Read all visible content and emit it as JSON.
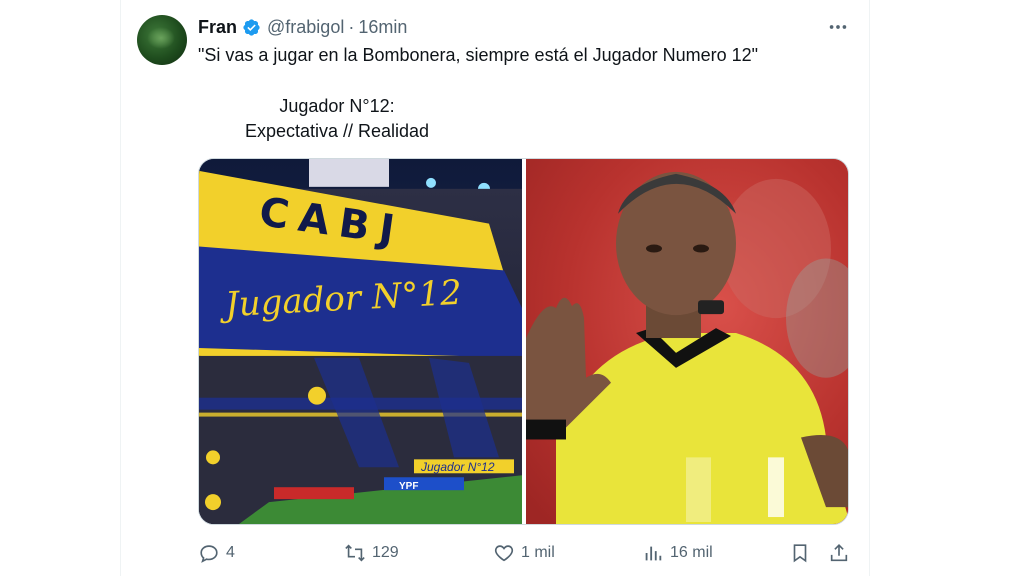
{
  "tweet": {
    "author_name": "Fran",
    "handle": "@frabigol",
    "separator": "·",
    "time": "16min",
    "text": "\"Si vas a jugar en la Bombonera, siempre está el Jugador Numero 12\"",
    "caption_line1": "Jugador N°12:",
    "caption_line2": "Expectativa // Realidad"
  },
  "media": {
    "left_banner_top": "CABJ",
    "left_banner_bottom": "Jugador N°12",
    "left_ad": "YPF",
    "left_small_banner": "Jugador N°12"
  },
  "actions": {
    "replies": "4",
    "retweets": "129",
    "likes": "1 mil",
    "views": "16 mil"
  },
  "icons": {
    "verified": "verified-badge-icon",
    "more": "more-dots-icon",
    "reply": "reply-icon",
    "retweet": "retweet-icon",
    "like": "heart-icon",
    "views": "views-chart-icon",
    "bookmark": "bookmark-icon",
    "share": "share-icon"
  },
  "colors": {
    "verified_blue": "#1d9bf0",
    "secondary_text": "#536471",
    "boca_blue": "#1d2f8f",
    "boca_yellow": "#f2d02b",
    "referee_yellow": "#e9e43a"
  }
}
